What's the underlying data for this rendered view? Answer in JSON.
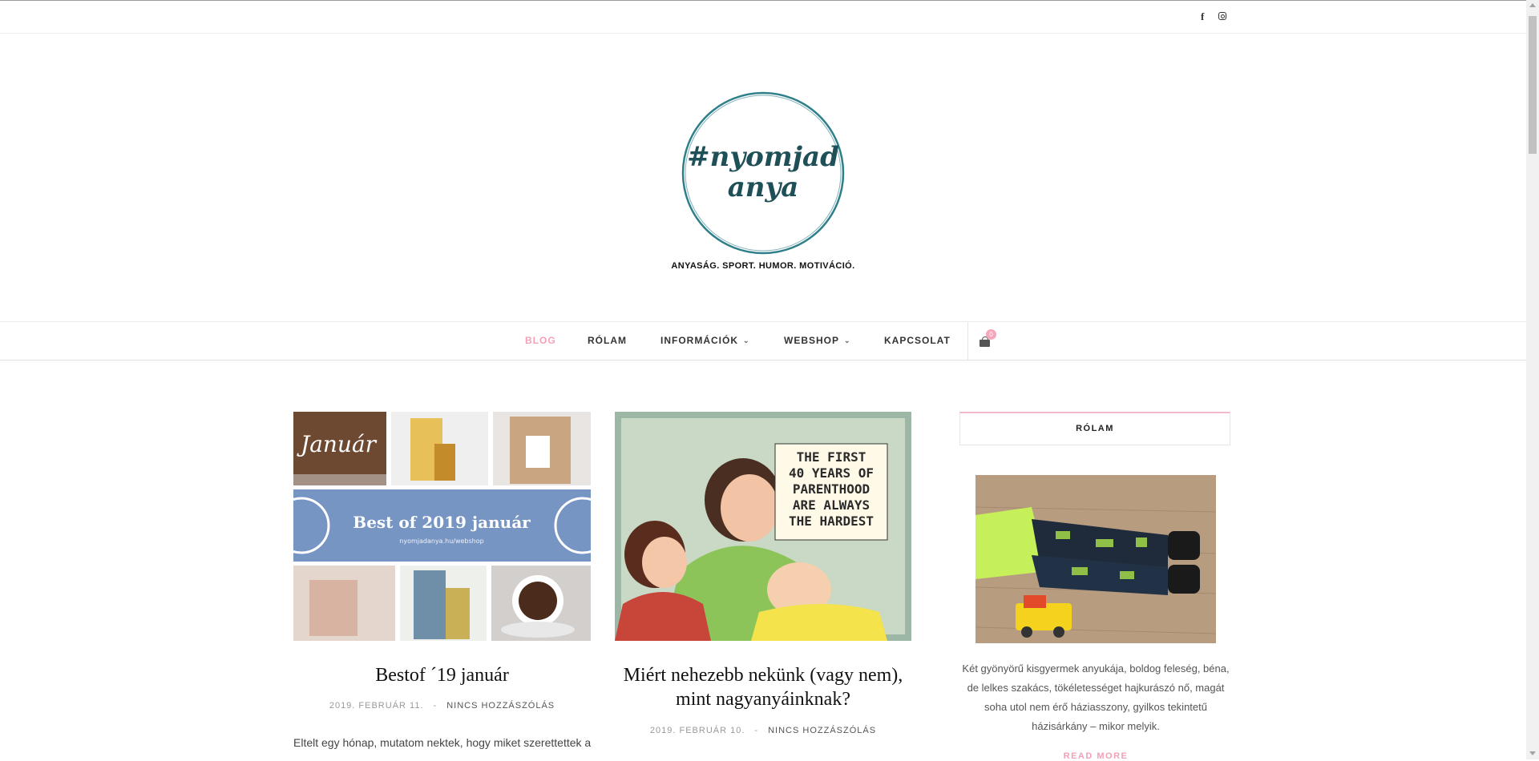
{
  "social": {
    "facebook_icon": "f",
    "instagram_icon": "instagram-icon"
  },
  "header": {
    "logo_line1": "#nyomjad",
    "logo_line2": "anya",
    "tagline": "ANYASÁG. SPORT. HUMOR. MOTIVÁCIÓ."
  },
  "nav": {
    "items": [
      {
        "label": "BLOG",
        "active": true
      },
      {
        "label": "RÓLAM"
      },
      {
        "label": "INFORMÁCIÓK",
        "has_dropdown": true
      },
      {
        "label": "WEBSHOP",
        "has_dropdown": true
      },
      {
        "label": "KAPCSOLAT"
      }
    ],
    "cart_count": "0"
  },
  "posts": [
    {
      "image_text": {
        "month": "Január",
        "banner_title": "Best of 2019 január",
        "banner_url": "nyomjadanya.hu/webshop"
      },
      "title": "Bestof ´19 január",
      "date": "2019. FEBRUÁR 11.",
      "separator": "-",
      "comments": "NINCS HOZZÁSZÓLÁS",
      "excerpt": "Eltelt egy hónap, mutatom nektek, hogy miket szerettettek a"
    },
    {
      "image_text": {
        "caption_lines": [
          "THE FIRST",
          "40 YEARS OF",
          "PARENTHOOD",
          "ARE ALWAYS",
          "THE HARDEST"
        ]
      },
      "title_line1": "Miért nehezebb nekünk (vagy nem),",
      "title_line2": "mint nagyanyáinknak?",
      "date": "2019. FEBRUÁR 10.",
      "separator": "-",
      "comments": "NINCS HOZZÁSZÓLÁS"
    }
  ],
  "sidebar": {
    "widget_title": "RÓLAM",
    "about_lines": [
      "Két gyönyörű kisgyermek anyukája, boldog feleség, béna,",
      "de lelkes szakács, tökéletességet hajkurászó nő, magát",
      "soha utol nem érő háziasszony, gyilkos tekintetű",
      "házisárkány – mikor melyik."
    ],
    "read_more": "READ MORE"
  },
  "colors": {
    "accent_pink": "#f2a0b6",
    "logo_teal": "#2e7f8a",
    "banner_blue": "#7795c2"
  }
}
